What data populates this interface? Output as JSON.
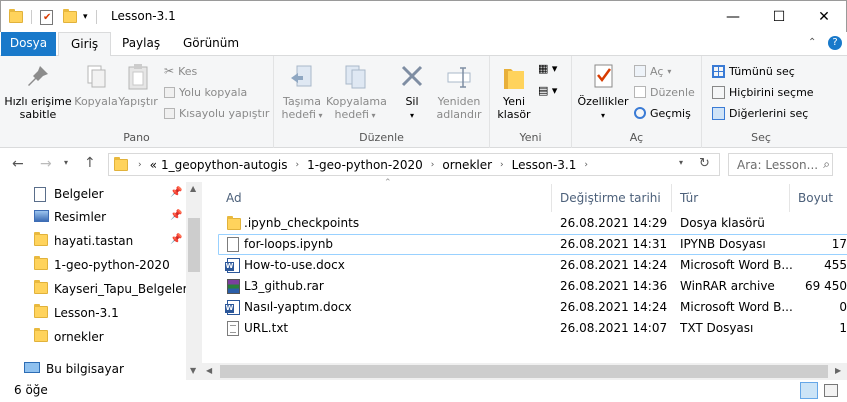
{
  "window": {
    "title": "Lesson-3.1",
    "minimize_glyph": "—",
    "maximize_glyph": "☐",
    "close_glyph": "✕"
  },
  "ribbon_tabs": [
    "Dosya",
    "Giriş",
    "Paylaş",
    "Görünüm"
  ],
  "ribbon": {
    "pano": {
      "label": "Pano",
      "pin_label_1": "Hızlı erişime",
      "pin_label_2": "sabitle",
      "copy": "Kopyala",
      "paste": "Yapıştır",
      "cut": "Kes",
      "copy_path": "Yolu kopyala",
      "paste_shortcut": "Kısayolu yapıştır"
    },
    "duzenle": {
      "label": "Düzenle",
      "move_1": "Taşıma",
      "move_2": "hedefi",
      "copy_1": "Kopyalama",
      "copy_2": "hedefi",
      "delete": "Sil",
      "rename_1": "Yeniden",
      "rename_2": "adlandır"
    },
    "yeni": {
      "label": "Yeni",
      "new_folder_1": "Yeni",
      "new_folder_2": "klasör"
    },
    "ac": {
      "label": "Aç",
      "properties": "Özellikler",
      "open": "Aç",
      "edit": "Düzenle",
      "history": "Geçmiş"
    },
    "sec": {
      "label": "Seç",
      "select_all": "Tümünü seç",
      "select_none": "Hiçbirini seçme",
      "invert": "Diğerlerini seç"
    }
  },
  "address": {
    "overflow": "«",
    "crumbs": [
      "1_geopython-autogis",
      "1-geo-python-2020",
      "ornekler",
      "Lesson-3.1"
    ],
    "search_placeholder": "Ara: Lesson..."
  },
  "nav": {
    "items": [
      {
        "label": "Belgeler",
        "icon": "documents-icon",
        "pinned": true
      },
      {
        "label": "Resimler",
        "icon": "pictures-icon",
        "pinned": true
      },
      {
        "label": "hayati.tastan",
        "icon": "folder-icon",
        "pinned": true
      },
      {
        "label": "1-geo-python-2020",
        "icon": "folder-icon",
        "pinned": false
      },
      {
        "label": "Kayseri_Tapu_Belgelerim",
        "icon": "folder-icon",
        "pinned": false
      },
      {
        "label": "Lesson-3.1",
        "icon": "folder-icon",
        "pinned": false
      },
      {
        "label": "ornekler",
        "icon": "folder-icon",
        "pinned": false
      }
    ],
    "this_pc": "Bu bilgisayar"
  },
  "columns": {
    "name": "Ad",
    "date": "Değiştirme tarihi",
    "type": "Tür",
    "size": "Boyut"
  },
  "files": [
    {
      "name": ".ipynb_checkpoints",
      "date": "26.08.2021 14:29",
      "type": "Dosya klasörü",
      "size": "",
      "icon": "folder-icon"
    },
    {
      "name": "for-loops.ipynb",
      "date": "26.08.2021 14:31",
      "type": "IPYNB Dosyası",
      "size": "17",
      "icon": "file-icon"
    },
    {
      "name": "How-to-use.docx",
      "date": "26.08.2021 14:24",
      "type": "Microsoft Word B...",
      "size": "455",
      "icon": "word-icon"
    },
    {
      "name": "L3_github.rar",
      "date": "26.08.2021 14:36",
      "type": "WinRAR archive",
      "size": "69 450",
      "icon": "rar-icon"
    },
    {
      "name": "Nasıl-yaptım.docx",
      "date": "26.08.2021 14:24",
      "type": "Microsoft Word B...",
      "size": "0",
      "icon": "word-icon"
    },
    {
      "name": "URL.txt",
      "date": "26.08.2021 14:07",
      "type": "TXT Dosyası",
      "size": "1",
      "icon": "text-file-icon"
    }
  ],
  "status": {
    "count": "6 öğe"
  }
}
